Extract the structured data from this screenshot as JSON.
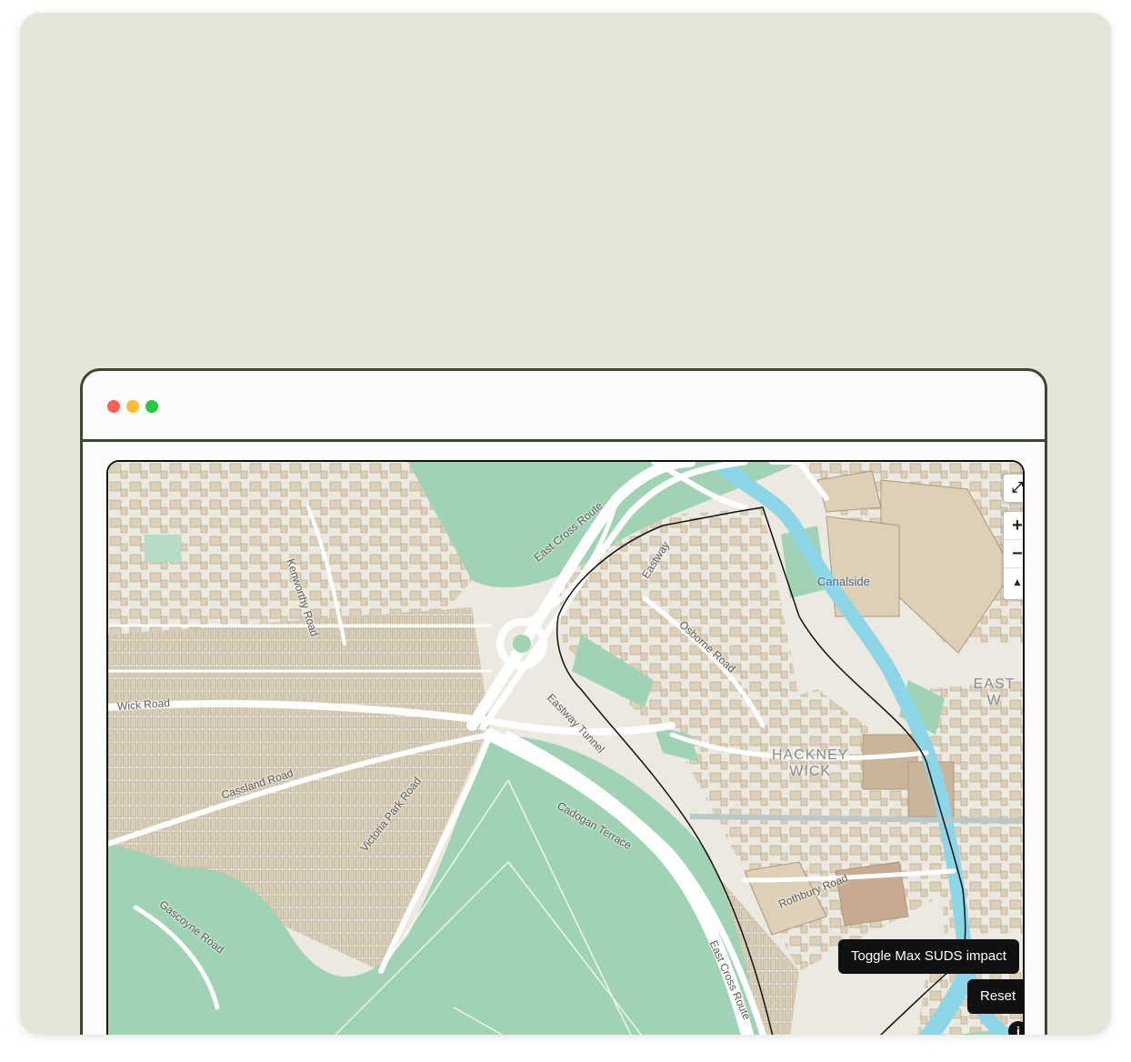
{
  "window": {
    "controls": [
      "close",
      "minimize",
      "maximize"
    ]
  },
  "map": {
    "labels": {
      "east_cross_route_north": "East Cross Route",
      "east_cross_route_south": "East Cross Route",
      "kenworthy_road": "Kenworthy Road",
      "eastway": "Eastway",
      "osborne_road": "Osborne Road",
      "eastway_tunnel": "Eastway Tunnel",
      "wick_road": "Wick Road",
      "cassland_road": "Cassland Road",
      "victoria_park_road": "Victoria Park Road",
      "cadogan_terrace": "Cadogan Terrace",
      "gascoyne_road": "Gascoyne Road",
      "rothbury_road": "Rothbury Road",
      "canalside": "Canalside",
      "hackney_wick_1": "HACKNEY",
      "hackney_wick_2": "WICK",
      "east_partial": "EAST W"
    },
    "controls": {
      "fullscreen_icon": "expand-arrows-icon",
      "zoom_in": "+",
      "zoom_out": "−",
      "compass": "▲"
    },
    "buttons": {
      "toggle": "Toggle Max SUDS impact",
      "reset": "Reset",
      "info": "i"
    },
    "colors": {
      "park": "#9fd3b3",
      "water": "#8cd6e8",
      "road": "#ffffff",
      "building": "#e0d3bc",
      "land": "#ece9e0",
      "boundary": "#111111"
    }
  }
}
